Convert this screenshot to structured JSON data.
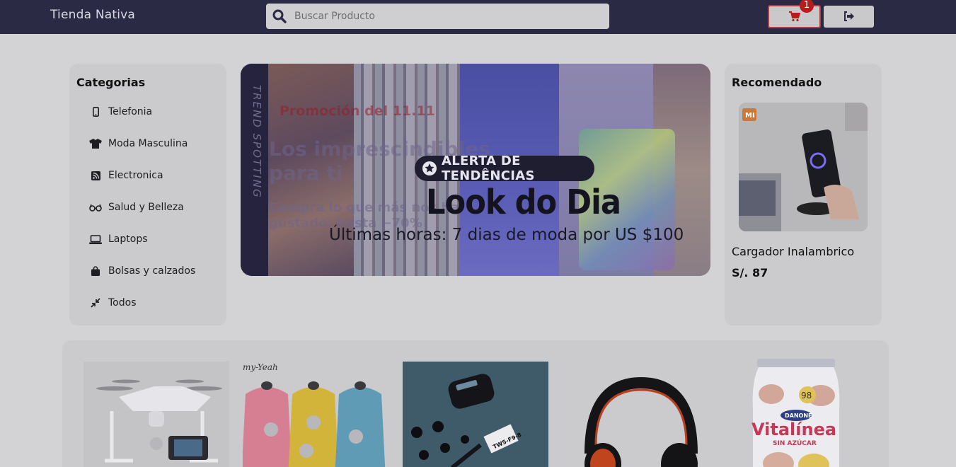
{
  "header": {
    "brand": "Tienda Nativa",
    "search_placeholder": "Buscar Producto",
    "cart_count": "1"
  },
  "categories": {
    "title": "Categorias",
    "items": [
      {
        "label": "Telefonia",
        "icon": "phone-icon"
      },
      {
        "label": "Moda Masculina",
        "icon": "tshirt-icon"
      },
      {
        "label": "Electronica",
        "icon": "rss-icon"
      },
      {
        "label": "Salud y Belleza",
        "icon": "glasses-icon"
      },
      {
        "label": "Laptops",
        "icon": "laptop-icon"
      },
      {
        "label": "Bolsas y calzados",
        "icon": "bag-icon"
      },
      {
        "label": "Todos",
        "icon": "compress-icon"
      }
    ]
  },
  "banner": {
    "tag": "ALERTA DE TENDÊNCIAS",
    "headline": "Look do Dia",
    "subline": "Últimas horas: 7 dias de moda por US $100",
    "strip_text": "TREND SPOTTING",
    "ghost_promo": "Promoción del 11.11",
    "ghost_headline": "Los imprescindibles para ti",
    "ghost_sub": "Compra lo que más nos ha gustado: hasta −70%"
  },
  "recommended": {
    "title": "Recomendado",
    "product_name": "Cargador Inalambrico",
    "price": "S/. 87",
    "brand_mark": "MI"
  },
  "products": [
    {
      "name": "drone",
      "icon": "drone-image"
    },
    {
      "name": "capes",
      "icon": "capes-image",
      "brand": "my-Yeah"
    },
    {
      "name": "earbuds",
      "icon": "earbuds-image",
      "label": "TWS-F9-8"
    },
    {
      "name": "headphones",
      "icon": "headphones-image"
    },
    {
      "name": "yogurt",
      "icon": "yogurt-image",
      "brand": "Vitalínea",
      "sub": "SIN AZÚCAR",
      "maker": "DANONE",
      "number": "98"
    }
  ],
  "colors": {
    "header_bg": "#2b2a45",
    "page_bg": "#d3d3d6",
    "panel_bg": "#cbcbcd",
    "accent_red": "#b61d1d"
  }
}
